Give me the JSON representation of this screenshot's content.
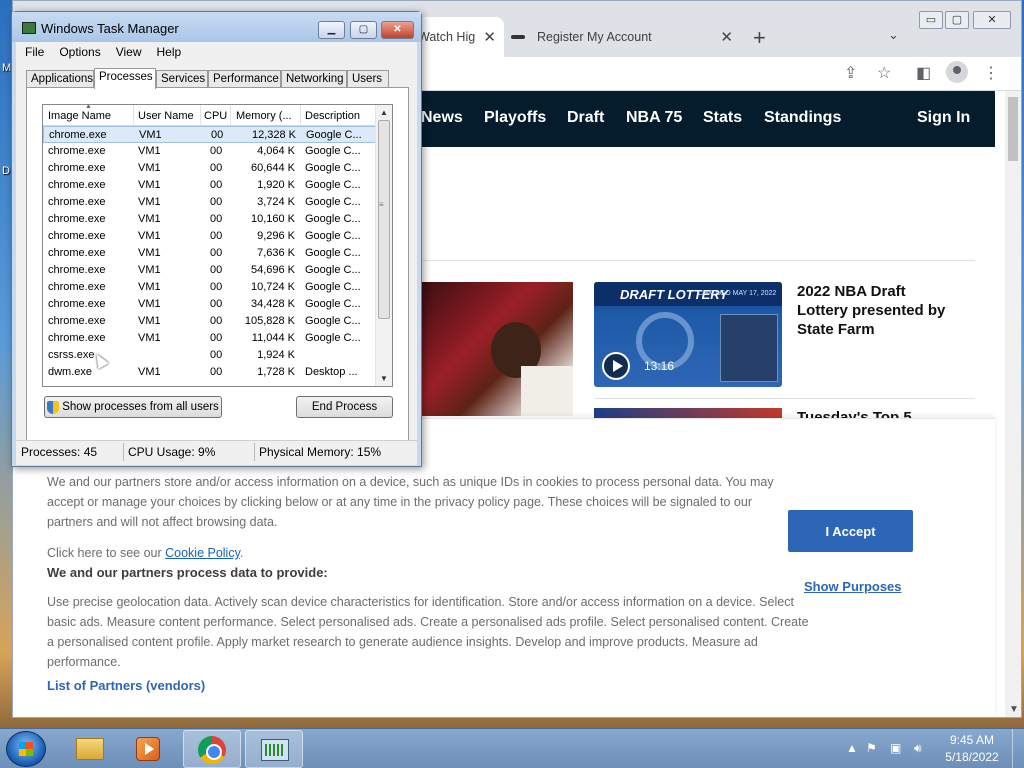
{
  "desktop": {
    "letters": [
      "M",
      "D"
    ]
  },
  "chrome": {
    "tabs": [
      {
        "label": "Watch Hig"
      },
      {
        "label": "Register My Account"
      }
    ],
    "new_tab": "+",
    "close_glyph": "✕",
    "tab_dropdown": "⌄",
    "window_controls": {
      "minimize": "▭",
      "maximize": "▢",
      "close": "✕"
    },
    "toolbar_icons": [
      "share-icon",
      "star-icon",
      "sidebar-icon",
      "profile-icon",
      "menu-icon"
    ],
    "nav": {
      "items": [
        "News",
        "Playoffs",
        "Draft",
        "NBA 75",
        "Stats",
        "Standings"
      ],
      "sign_in": "Sign In",
      "background": "#051c2d"
    },
    "video": {
      "banner": "DRAFT LOTTERY",
      "meta": "CHICAGO   MAY 17, 2022",
      "duration": "13:16",
      "headline": "2022 NBA Draft Lottery presented by State Farm"
    },
    "second_headline": "Tuesday's Top 5",
    "cookie": {
      "intro": "We and our partners store and/or access information on a device, such as unique IDs in cookies to process personal data. You may accept or manage your choices by clicking below or at any time in the privacy policy page. These choices will be signaled to our partners and will not affect browsing data.",
      "cookie_policy_prefix": "Click here to see our ",
      "cookie_policy_link": "Cookie Policy",
      "cookie_policy_suffix": ".",
      "process_heading": "We and our partners process data to provide:",
      "purposes_text": "Use precise geolocation data. Actively scan device characteristics for identification. Store and/or access information on a device. Select basic ads. Measure content performance. Select personalised ads. Create a personalised ads profile. Select personalised content. Create a personalised content profile. Apply market research to generate audience insights. Develop and improve products. Measure ad performance.",
      "partners_link": "List of Partners (vendors)",
      "accept": "I Accept",
      "show_purposes": "Show Purposes",
      "accent": "#2d66b7"
    }
  },
  "taskmanager": {
    "title": "Windows Task Manager",
    "menu": [
      "File",
      "Options",
      "View",
      "Help"
    ],
    "tabs": [
      "Applications",
      "Processes",
      "Services",
      "Performance",
      "Networking",
      "Users"
    ],
    "active_tab": "Processes",
    "columns": [
      "Image Name",
      "User Name",
      "CPU",
      "Memory (...",
      "Description"
    ],
    "rows": [
      {
        "image": "chrome.exe",
        "user": "VM1",
        "cpu": "00",
        "mem": "12,328 K",
        "desc": "Google C..."
      },
      {
        "image": "chrome.exe",
        "user": "VM1",
        "cpu": "00",
        "mem": "4,064 K",
        "desc": "Google C..."
      },
      {
        "image": "chrome.exe",
        "user": "VM1",
        "cpu": "00",
        "mem": "60,644 K",
        "desc": "Google C..."
      },
      {
        "image": "chrome.exe",
        "user": "VM1",
        "cpu": "00",
        "mem": "1,920 K",
        "desc": "Google C..."
      },
      {
        "image": "chrome.exe",
        "user": "VM1",
        "cpu": "00",
        "mem": "3,724 K",
        "desc": "Google C..."
      },
      {
        "image": "chrome.exe",
        "user": "VM1",
        "cpu": "00",
        "mem": "10,160 K",
        "desc": "Google C..."
      },
      {
        "image": "chrome.exe",
        "user": "VM1",
        "cpu": "00",
        "mem": "9,296 K",
        "desc": "Google C..."
      },
      {
        "image": "chrome.exe",
        "user": "VM1",
        "cpu": "00",
        "mem": "7,636 K",
        "desc": "Google C..."
      },
      {
        "image": "chrome.exe",
        "user": "VM1",
        "cpu": "00",
        "mem": "54,696 K",
        "desc": "Google C..."
      },
      {
        "image": "chrome.exe",
        "user": "VM1",
        "cpu": "00",
        "mem": "10,724 K",
        "desc": "Google C..."
      },
      {
        "image": "chrome.exe",
        "user": "VM1",
        "cpu": "00",
        "mem": "34,428 K",
        "desc": "Google C..."
      },
      {
        "image": "chrome.exe",
        "user": "VM1",
        "cpu": "00",
        "mem": "105,828 K",
        "desc": "Google C..."
      },
      {
        "image": "chrome.exe",
        "user": "VM1",
        "cpu": "00",
        "mem": "11,044 K",
        "desc": "Google C..."
      },
      {
        "image": "csrss.exe",
        "user": "",
        "cpu": "00",
        "mem": "1,924 K",
        "desc": ""
      },
      {
        "image": "dwm.exe",
        "user": "VM1",
        "cpu": "00",
        "mem": "1,728 K",
        "desc": "Desktop ..."
      }
    ],
    "show_all_button": "Show processes from all users",
    "end_process_button": "End Process",
    "status": {
      "processes": "Processes: 45",
      "cpu": "CPU Usage: 9%",
      "memory": "Physical Memory: 15%"
    }
  },
  "taskbar": {
    "apps": [
      "folder-icon",
      "media-player-icon",
      "chrome-icon",
      "task-manager-icon"
    ],
    "tray_icons": [
      "show-hidden-icons",
      "action-center-icon",
      "network-icon",
      "volume-icon"
    ],
    "time": "9:45 AM",
    "date": "5/18/2022"
  }
}
